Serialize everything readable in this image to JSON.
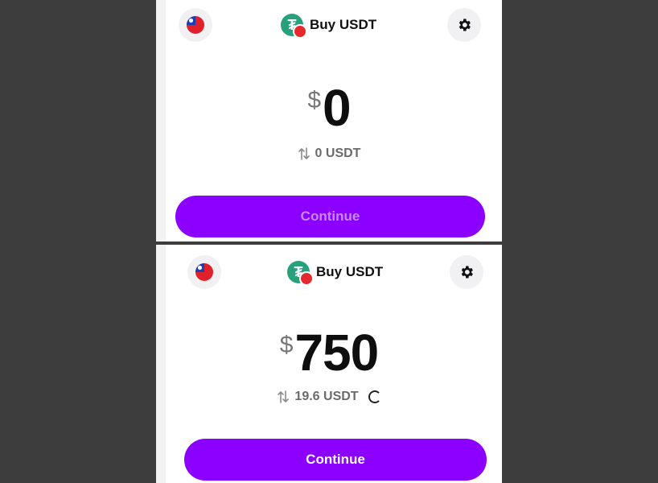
{
  "screens": [
    {
      "title": "Buy USDT",
      "currency_symbol": "$",
      "amount": "0",
      "conversion": "0 USDT",
      "continue_label": "Continue",
      "continue_state": "disabled",
      "flag_icon": "taiwan-flag-icon",
      "settings_icon": "gear-icon",
      "token_icon": "usdt-tron-icon"
    },
    {
      "title": "Buy USDT",
      "currency_symbol": "$",
      "amount": "750",
      "conversion": "19.6 USDT",
      "continue_label": "Continue",
      "continue_state": "enabled",
      "flag_icon": "taiwan-flag-icon",
      "settings_icon": "gear-icon",
      "token_icon": "usdt-tron-icon",
      "loading": true
    }
  ],
  "colors": {
    "background": "#3d3d3d",
    "accent": "#8c00ff",
    "usdt_green": "#26a17b",
    "tron_red": "#e6282f"
  }
}
